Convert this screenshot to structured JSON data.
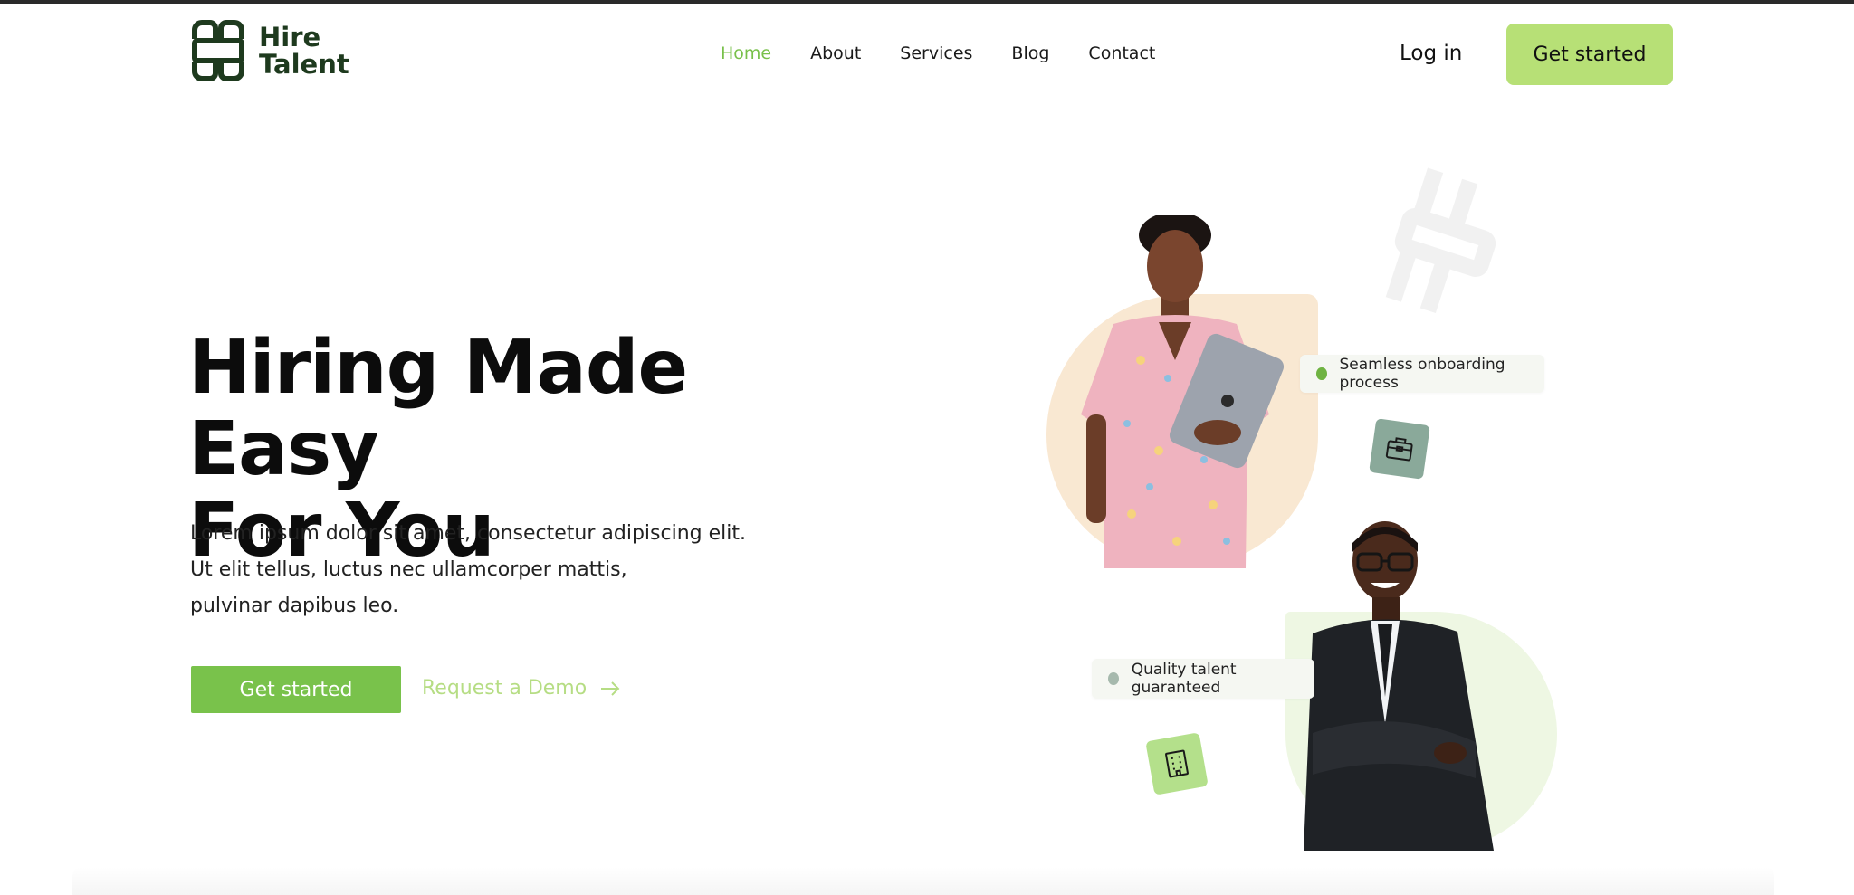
{
  "header": {
    "logo_line1": "Hire",
    "logo_line2": "Talent",
    "nav": [
      "Home",
      "About",
      "Services",
      "Blog",
      "Contact"
    ],
    "active_nav": "Home",
    "login_label": "Log in",
    "cta_label": "Get started"
  },
  "hero": {
    "title_line1": "Hiring Made Easy",
    "title_line2": "For You",
    "text_line1": "Lorem ipsum dolor sit amet, consectetur adipiscing elit.",
    "text_line2": "Ut elit tellus, luctus nec ullamcorper mattis,",
    "text_line3": "pulvinar dapibus leo.",
    "primary_button": "Get started",
    "demo_link": "Request a Demo"
  },
  "features": {
    "chip1": "Seamless onboarding process",
    "chip2": "Quality talent guaranteed"
  },
  "colors": {
    "accent_green": "#79c24b",
    "light_green": "#b7e076",
    "peach": "#f9e8d2",
    "mint": "#eef7e3"
  },
  "icons": [
    "logo-mark-icon",
    "arrow-right-icon",
    "briefcase-icon",
    "building-icon"
  ]
}
